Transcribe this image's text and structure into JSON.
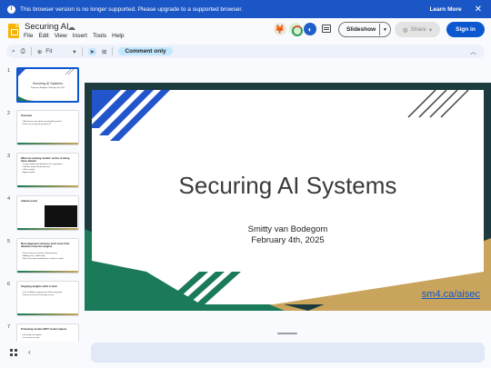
{
  "banner": {
    "message": "This browser version is no longer supported. Please upgrade to a supported browser.",
    "learn_more": "Learn More",
    "close": "✕"
  },
  "header": {
    "title": "Securing AI",
    "menu": [
      "File",
      "Edit",
      "View",
      "Insert",
      "Tools",
      "Help"
    ],
    "slideshow_label": "Slideshow",
    "share_label": "Share",
    "signin_label": "Sign in"
  },
  "toolbar": {
    "zoom": "Fit",
    "comment_only": "Comment only"
  },
  "filmstrip": {
    "slides": [
      {
        "num": "1",
        "title": "Securing AI Systems",
        "sub": "Smitty van Bodegom / February 4th, 2025"
      },
      {
        "num": "2",
        "title": "Overview",
        "body": "• Why do we care about securing AI systems?\n• How can we (try to) go about it?"
      },
      {
        "num": "3",
        "title": "What are existing models' notion of doing these attacks",
        "body": "• Large models specifically for the competition\n• Smaller models limited by cost\n• Other models\n• Agent models"
      },
      {
        "num": "4",
        "title": "Attacks (cont)",
        "body": ""
      },
      {
        "num": "5",
        "title": "Most alignment schemes don't work if the attackers have the weights",
        "body": "• Fine-tuning can remove safety training\n• Adding noise, abliteration\n• Much less data needed than to make a model"
      },
      {
        "num": "6",
        "title": "Stopping weights exfils is hard",
        "body": "• Lots of different approaches with many gaps\n• Not yet at the level of being secure"
      },
      {
        "num": "7",
        "title": "Protecting models ISN'T model outputs",
        "body": "• Securing not weights\n• Lots more to cover"
      }
    ]
  },
  "slide": {
    "title": "Securing AI Systems",
    "author": "Smitty van Bodegom",
    "date": "February 4th, 2025",
    "link": "sm4.ca/aisec"
  },
  "colors": {
    "banner": "#1a56c6",
    "accent_blue": "#2255cc",
    "teal": "#1a7a5a",
    "tan": "#c9a45c",
    "dark_teal": "#1d3b3f"
  }
}
